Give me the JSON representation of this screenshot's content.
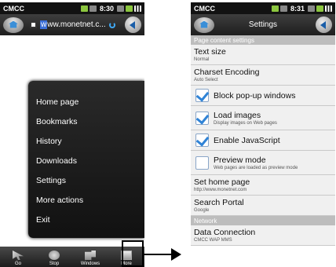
{
  "left_screen": {
    "status": {
      "carrier": "CMCC",
      "time": "8:30"
    },
    "url_prefix": "w",
    "url": "ww.monetnet.c...",
    "menu_items": [
      "Home page",
      "Bookmarks",
      "History",
      "Downloads",
      "Settings",
      "More actions",
      "Exit"
    ],
    "toolbar": [
      {
        "label": "Go",
        "icon": "go-icon"
      },
      {
        "label": "Stop",
        "icon": "stop-icon"
      },
      {
        "label": "Windows",
        "icon": "windows-icon"
      },
      {
        "label": "More",
        "icon": "more-icon"
      }
    ]
  },
  "right_screen": {
    "status": {
      "carrier": "CMCC",
      "time": "8:31"
    },
    "title": "Settings",
    "section_page": "Page content settings",
    "section_network": "Network",
    "rows": {
      "text_size": {
        "title": "Text size",
        "sub": "Normal"
      },
      "charset": {
        "title": "Charset Encoding",
        "sub": "Auto Select"
      },
      "block_popups": {
        "title": "Block pop-up windows",
        "checked": true
      },
      "load_images": {
        "title": "Load images",
        "sub": "Display images on Web pages",
        "checked": true
      },
      "javascript": {
        "title": "Enable JavaScript",
        "checked": true
      },
      "preview": {
        "title": "Preview mode",
        "sub": "Web pages are loaded as preview mode",
        "checked": false
      },
      "home_page": {
        "title": "Set home page",
        "sub": "http://www.monetnet.com"
      },
      "search_portal": {
        "title": "Search Portal",
        "sub": "Google"
      },
      "data_connection": {
        "title": "Data Connection",
        "sub": "CMCC WAP MMS"
      }
    }
  }
}
